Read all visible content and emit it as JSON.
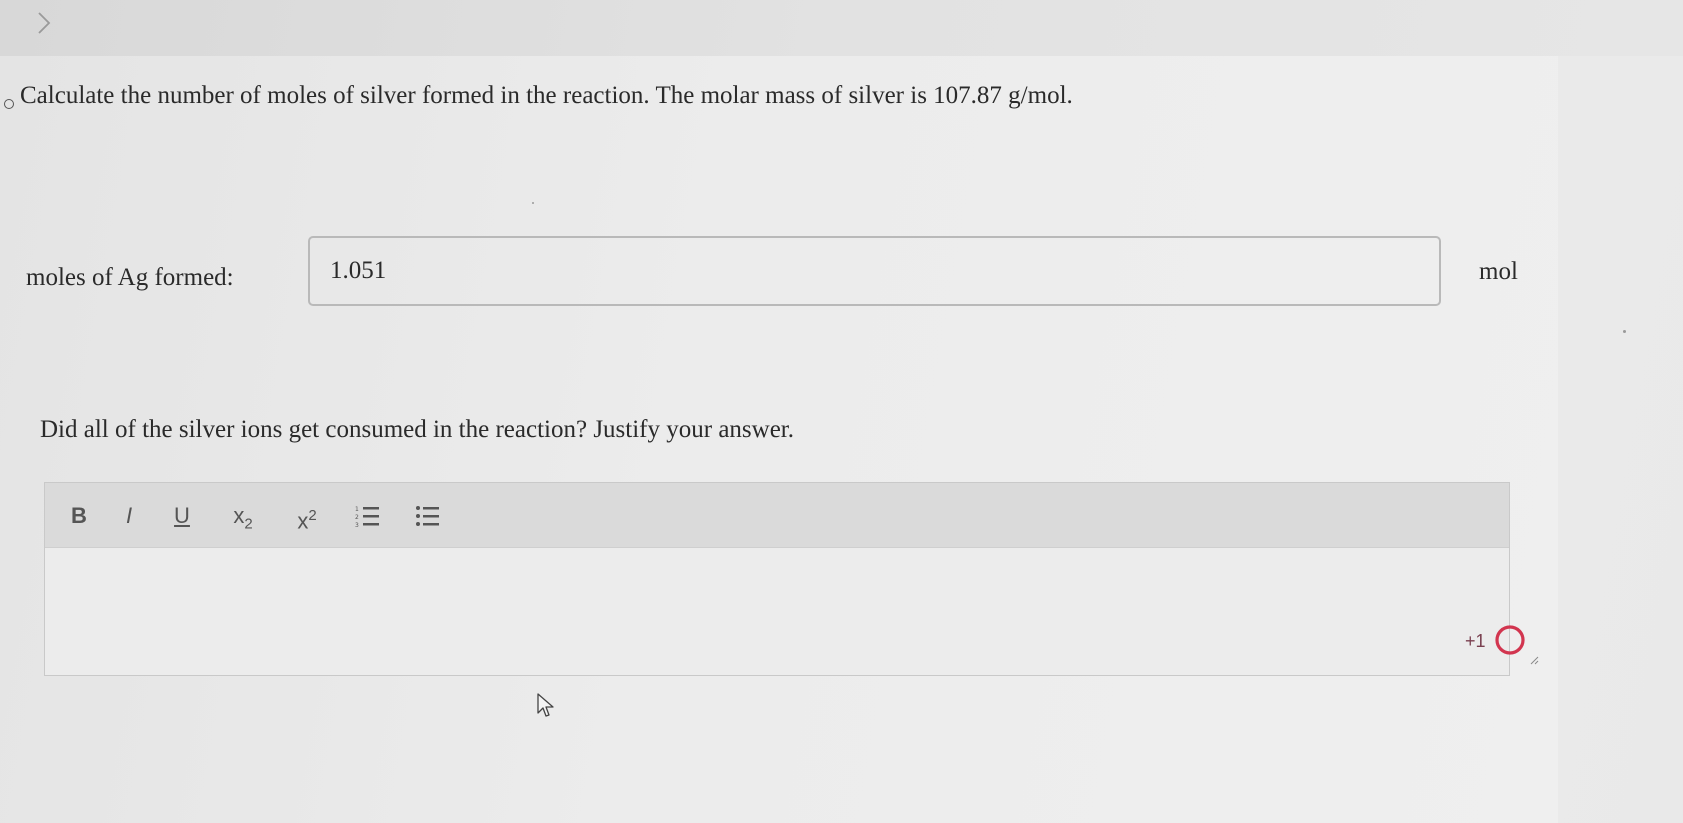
{
  "nav": {
    "chevron_icon": "chevron-right-icon"
  },
  "question": {
    "text": "Calculate the number of moles of silver formed in the reaction. The molar mass of silver is 107.87 g/mol."
  },
  "answer": {
    "label": "moles of Ag formed:",
    "value": "1.051",
    "unit": "mol"
  },
  "question2": {
    "text": "Did all of the silver ions get consumed in the reaction? Justify your answer."
  },
  "editor": {
    "toolbar": {
      "bold": "B",
      "italic": "I",
      "underline": "U",
      "subscript_base": "x",
      "subscript_mark": "2",
      "superscript_base": "x",
      "superscript_mark": "2",
      "ordered_list_icon": "ordered-list-icon",
      "unordered_list_icon": "unordered-list-icon"
    },
    "content": "",
    "counter_text": "+1",
    "status_icon": "grammarly-ring-icon",
    "accent_color": "#d2354f"
  }
}
